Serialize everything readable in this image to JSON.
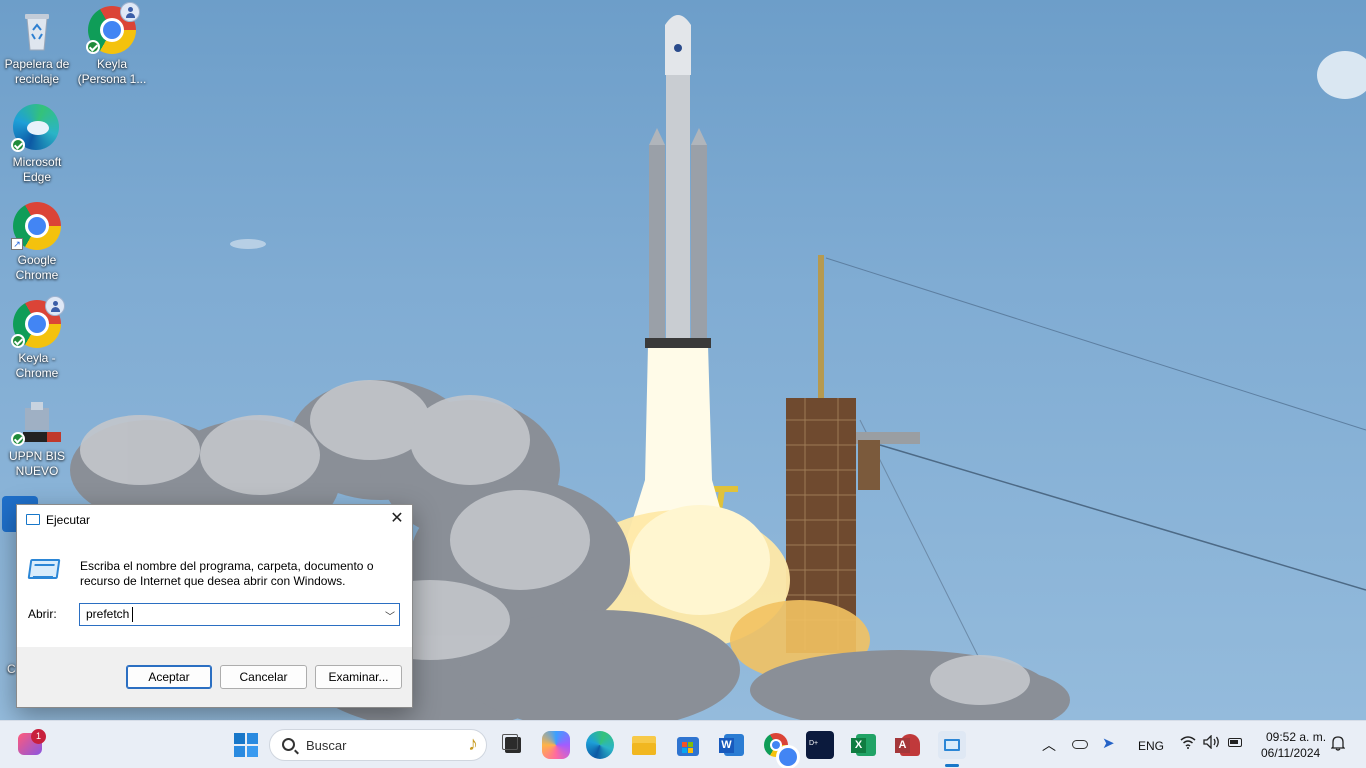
{
  "desktop": {
    "icons": [
      {
        "label": "Papelera de reciclaje",
        "icon": "recycle-bin-icon"
      },
      {
        "label": "Keyla (Persona 1...",
        "icon": "chrome-profile-icon"
      },
      {
        "label": "Microsoft Edge",
        "icon": "edge-icon"
      },
      {
        "label": "Google Chrome",
        "icon": "chrome-icon"
      },
      {
        "label": "Keyla - Chrome",
        "icon": "chrome-profile-icon"
      },
      {
        "label": "UPPN BIS NUEVO",
        "icon": "building-icon"
      }
    ],
    "partial_label": "C"
  },
  "run_dialog": {
    "title": "Ejecutar",
    "description": "Escriba el nombre del programa, carpeta, documento o recurso de Internet que desea abrir con Windows.",
    "open_label": "Abrir:",
    "input_value": "prefetch",
    "buttons": {
      "ok": "Aceptar",
      "cancel": "Cancelar",
      "browse": "Examinar..."
    },
    "accent": "#1877c9"
  },
  "taskbar": {
    "search_placeholder": "Buscar",
    "notification_count": "1",
    "apps": [
      "start-icon",
      "task-view-icon",
      "copilot-icon",
      "edge-icon",
      "file-explorer-icon",
      "store-icon",
      "word-icon",
      "chrome-icon",
      "disney-plus-icon",
      "excel-icon",
      "access-icon",
      "run-icon"
    ],
    "tray": {
      "language": "ENG",
      "time": "09:52 a. m.",
      "date": "06/11/2024"
    }
  }
}
